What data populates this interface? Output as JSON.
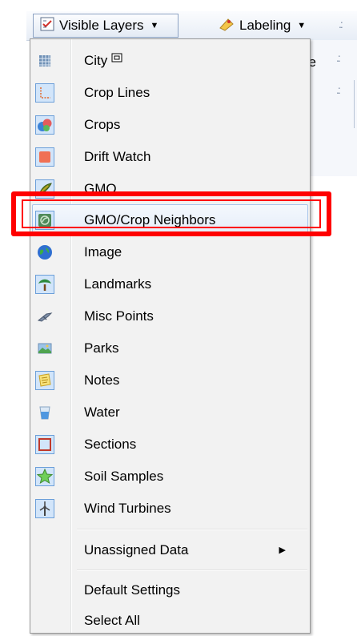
{
  "toolbar": {
    "visible_layers_label": "Visible Layers",
    "labeling_label": "Labeling",
    "behind_text": "de"
  },
  "menu": {
    "items": [
      {
        "label": "City",
        "icon": "city-grid-icon",
        "checked": false
      },
      {
        "label": "Crop Lines",
        "icon": "crop-lines-icon",
        "checked": true
      },
      {
        "label": "Crops",
        "icon": "crops-icon",
        "checked": true
      },
      {
        "label": "Drift Watch",
        "icon": "drift-watch-icon",
        "checked": true
      },
      {
        "label": "GMO",
        "icon": "gmo-icon",
        "checked": true
      },
      {
        "label": "GMO/Crop Neighbors",
        "icon": "gmo-crop-neighbors-icon",
        "checked": true
      },
      {
        "label": "Image",
        "icon": "globe-icon",
        "checked": false
      },
      {
        "label": "Landmarks",
        "icon": "landmarks-icon",
        "checked": true
      },
      {
        "label": "Misc Points",
        "icon": "misc-points-icon",
        "checked": false
      },
      {
        "label": "Parks",
        "icon": "parks-icon",
        "checked": false
      },
      {
        "label": "Notes",
        "icon": "notes-icon",
        "checked": true
      },
      {
        "label": "Water",
        "icon": "water-icon",
        "checked": false
      },
      {
        "label": "Sections",
        "icon": "sections-icon",
        "checked": true
      },
      {
        "label": "Soil Samples",
        "icon": "soil-samples-icon",
        "checked": true
      },
      {
        "label": "Wind Turbines",
        "icon": "wind-turbine-icon",
        "checked": true
      }
    ],
    "unassigned_label": "Unassigned Data",
    "default_settings_label": "Default Settings",
    "select_all_label": "Select All"
  },
  "highlight_color": "#ff0000",
  "check_bg_color": "#d2e5fa"
}
